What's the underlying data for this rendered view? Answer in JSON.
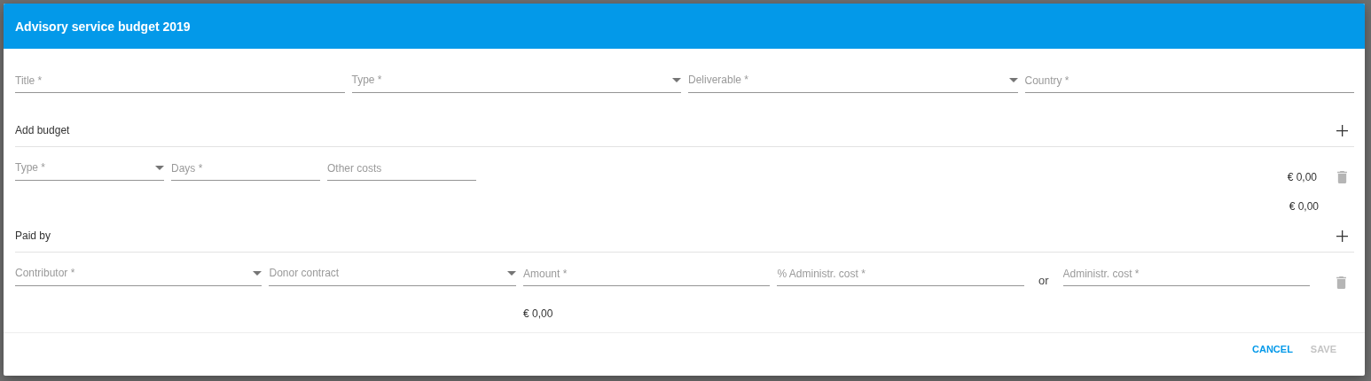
{
  "dialog": {
    "title": "Advisory service budget 2019"
  },
  "fields": [
    {
      "kind": "text",
      "placeholder": "Title *"
    },
    {
      "kind": "select",
      "placeholder": "Type *"
    },
    {
      "kind": "select",
      "placeholder": "Deliverable *"
    },
    {
      "kind": "text",
      "placeholder": "Country *"
    }
  ],
  "budget": {
    "heading": "Add budget",
    "lines": [
      {
        "fields": [
          {
            "kind": "select",
            "placeholder": "Type *"
          },
          {
            "kind": "text",
            "placeholder": "Days *"
          },
          {
            "kind": "text",
            "placeholder": "Other costs"
          }
        ],
        "total": "€ 0,00"
      }
    ],
    "subtotal": "€ 0,00"
  },
  "paid_by": {
    "heading": "Paid by",
    "lines": [
      {
        "fields": [
          {
            "kind": "select",
            "placeholder": "Contributor *"
          },
          {
            "kind": "select",
            "placeholder": "Donor contract"
          },
          {
            "kind": "text",
            "placeholder": "Amount *",
            "total": "€ 0,00"
          },
          {
            "kind": "text",
            "placeholder": "% Administr. cost *"
          },
          {
            "kind": "word",
            "text": "or"
          },
          {
            "kind": "text",
            "placeholder": "Administr. cost *"
          }
        ]
      }
    ]
  },
  "buttons": [
    {
      "label": "CANCEL",
      "disabled": false
    },
    {
      "label": "SAVE",
      "disabled": true
    }
  ]
}
